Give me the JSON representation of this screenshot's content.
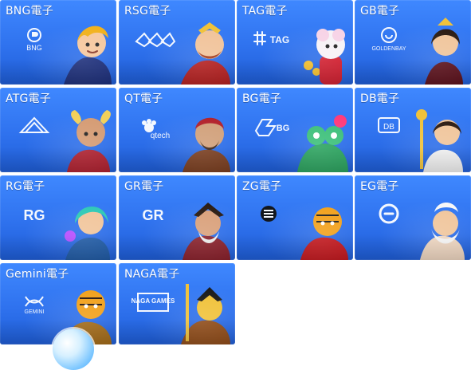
{
  "tiles": [
    {
      "title": "BNG電子",
      "logo_text": "BNG"
    },
    {
      "title": "RSG電子",
      "logo_text": ""
    },
    {
      "title": "TAG電子",
      "logo_text": "TAG"
    },
    {
      "title": "GB電子",
      "logo_text": "GOLDENBAY"
    },
    {
      "title": "ATG電子",
      "logo_text": ""
    },
    {
      "title": "QT電子",
      "logo_text": "qtech"
    },
    {
      "title": "BG電子",
      "logo_text": "BG"
    },
    {
      "title": "DB電子",
      "logo_text": "DB"
    },
    {
      "title": "RG電子",
      "logo_text": "RG"
    },
    {
      "title": "GR電子",
      "logo_text": "GR"
    },
    {
      "title": "ZG電子",
      "logo_text": ""
    },
    {
      "title": "EG電子",
      "logo_text": ""
    },
    {
      "title": "Gemini電子",
      "logo_text": "GEMINI"
    },
    {
      "title": "NAGA電子",
      "logo_text": "NAGA GAMES"
    }
  ],
  "colors": {
    "tile_blue": "#2f72ee",
    "tile_blue_light": "#3f88ff",
    "text": "#ffffff"
  }
}
